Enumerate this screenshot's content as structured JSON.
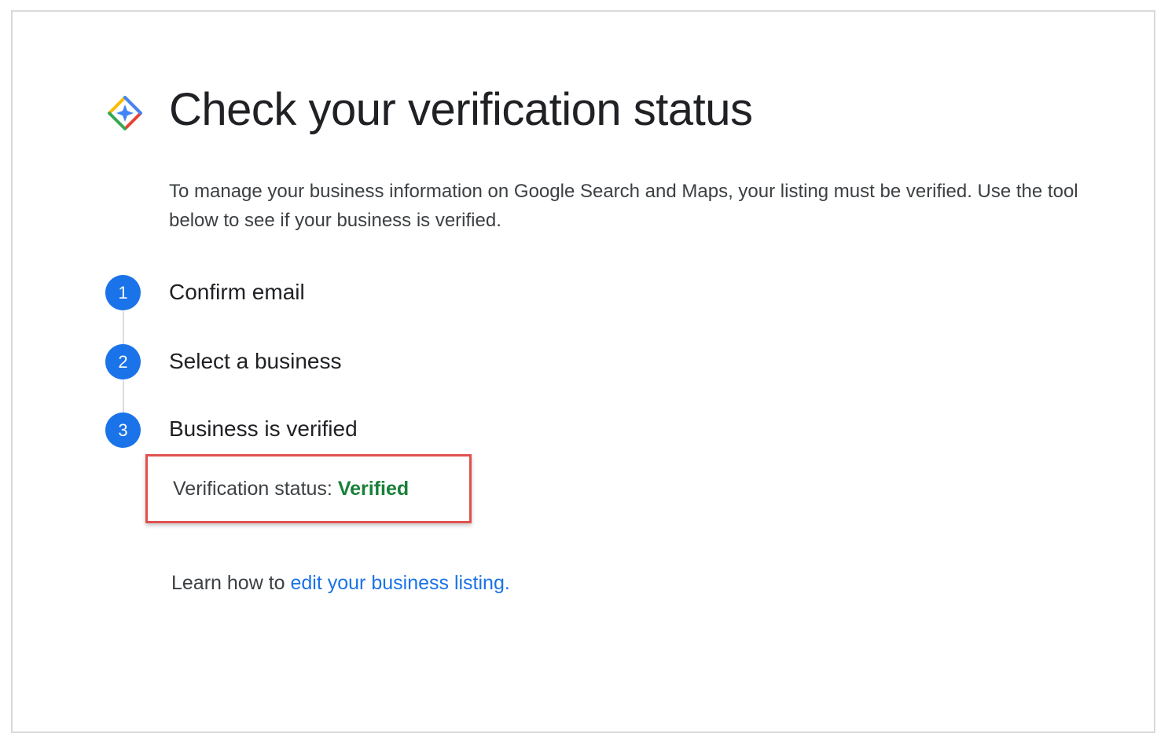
{
  "header": {
    "title": "Check your verification status",
    "logo_icon": "google-business-diamond-icon"
  },
  "intro": {
    "text": "To manage your business information on Google Search and Maps, your listing must be verified. Use the tool below to see if your business is verified."
  },
  "steps": [
    {
      "number": "1",
      "label": "Confirm email"
    },
    {
      "number": "2",
      "label": "Select a business"
    },
    {
      "number": "3",
      "label": "Business is verified"
    }
  ],
  "status": {
    "label": "Verification status:",
    "value": "Verified"
  },
  "learn": {
    "prefix": "Learn how to",
    "link_text": "edit your business listing",
    "suffix": "."
  },
  "colors": {
    "step_blue": "#1a73e8",
    "verified_green": "#188038",
    "highlight_red": "#e0524f",
    "link_blue": "#1a73e8"
  }
}
